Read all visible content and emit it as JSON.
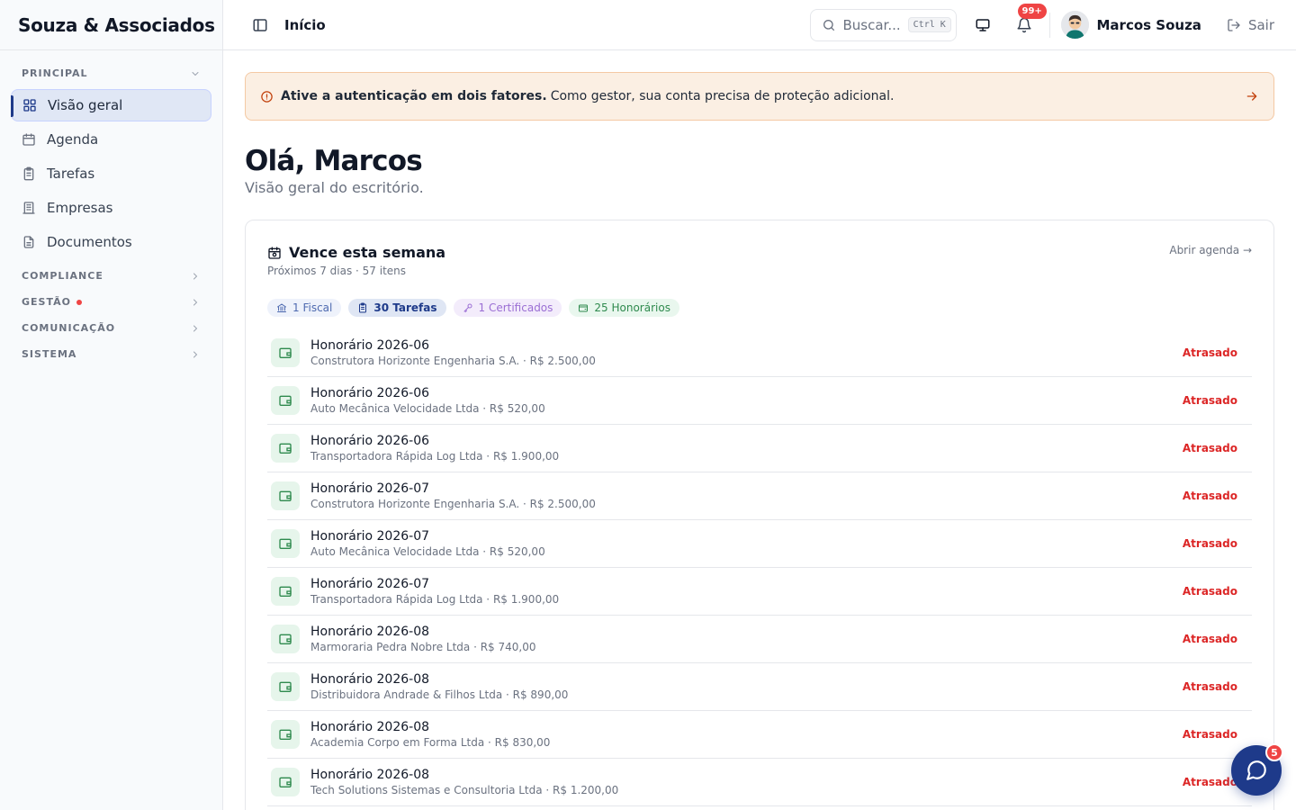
{
  "brand": "Souza & Associados",
  "sidebar": {
    "section_principal": "PRINCIPAL",
    "items": [
      {
        "label": "Visão geral",
        "icon": "grid-icon",
        "active": true
      },
      {
        "label": "Agenda",
        "icon": "calendar-icon"
      },
      {
        "label": "Tarefas",
        "icon": "clipboard-icon"
      },
      {
        "label": "Empresas",
        "icon": "building-icon"
      },
      {
        "label": "Documentos",
        "icon": "document-icon"
      }
    ],
    "sections": [
      {
        "label": "COMPLIANCE"
      },
      {
        "label": "GESTÃO",
        "has_dot": true
      },
      {
        "label": "COMUNICAÇÃO"
      },
      {
        "label": "SISTEMA"
      }
    ]
  },
  "header": {
    "breadcrumb": "Início",
    "search_placeholder": "Buscar...",
    "search_shortcut": "Ctrl K",
    "notifications_badge": "99+",
    "user_name": "Marcos Souza",
    "logout_label": "Sair"
  },
  "alert": {
    "strong": "Ative a autenticação em dois fatores.",
    "text": "Como gestor, sua conta precisa de proteção adicional."
  },
  "greeting": {
    "title": "Olá, Marcos",
    "subtitle": "Visão geral do escritório."
  },
  "card": {
    "title": "Vence esta semana",
    "subtitle": "Próximos 7 dias · 57 itens",
    "link": "Abrir agenda →",
    "chips": [
      {
        "label": "1 Fiscal",
        "icon": "bank-icon"
      },
      {
        "label": "30 Tarefas",
        "icon": "clipboard-icon"
      },
      {
        "label": "1 Certificados",
        "icon": "key-icon"
      },
      {
        "label": "25 Honorários",
        "icon": "wallet-icon"
      }
    ],
    "rows": [
      {
        "title": "Honorário 2026-06",
        "meta": "Construtora Horizonte Engenharia S.A. · R$ 2.500,00",
        "status": "Atrasado"
      },
      {
        "title": "Honorário 2026-06",
        "meta": "Auto Mecânica Velocidade Ltda · R$ 520,00",
        "status": "Atrasado"
      },
      {
        "title": "Honorário 2026-06",
        "meta": "Transportadora Rápida Log Ltda · R$ 1.900,00",
        "status": "Atrasado"
      },
      {
        "title": "Honorário 2026-07",
        "meta": "Construtora Horizonte Engenharia S.A. · R$ 2.500,00",
        "status": "Atrasado"
      },
      {
        "title": "Honorário 2026-07",
        "meta": "Auto Mecânica Velocidade Ltda · R$ 520,00",
        "status": "Atrasado"
      },
      {
        "title": "Honorário 2026-07",
        "meta": "Transportadora Rápida Log Ltda · R$ 1.900,00",
        "status": "Atrasado"
      },
      {
        "title": "Honorário 2026-08",
        "meta": "Marmoraria Pedra Nobre Ltda · R$ 740,00",
        "status": "Atrasado"
      },
      {
        "title": "Honorário 2026-08",
        "meta": "Distribuidora Andrade & Filhos Ltda · R$ 890,00",
        "status": "Atrasado"
      },
      {
        "title": "Honorário 2026-08",
        "meta": "Academia Corpo em Forma Ltda · R$ 830,00",
        "status": "Atrasado"
      },
      {
        "title": "Honorário 2026-08",
        "meta": "Tech Solutions Sistemas e Consultoria Ltda · R$ 1.200,00",
        "status": "Atrasado"
      }
    ]
  },
  "chat": {
    "badge": "5"
  },
  "colors": {
    "accent": "#1e3a8a",
    "danger": "#dc2626",
    "alert_bg": "#fbefe3",
    "success_bg": "#e6f5eb"
  }
}
